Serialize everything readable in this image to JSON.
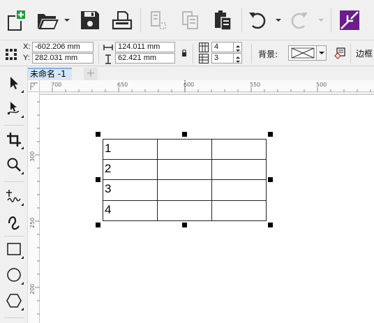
{
  "property_bar": {
    "x_label": "X:",
    "x_value": "-602.206 mm",
    "y_label": "Y:",
    "y_value": "282.031 mm",
    "width_value": "124.011 mm",
    "height_value": "62.421 mm",
    "columns_value": "4",
    "rows_value": "3",
    "background_label": "背景:",
    "border_label": "边框"
  },
  "tab": {
    "document_name": "未命名 -1",
    "new_tab_label": "+"
  },
  "rulers": {
    "top_numbers": [
      "700",
      "650",
      "600",
      "550",
      "500"
    ],
    "left_numbers": [
      "300",
      "250",
      "200"
    ]
  },
  "table": {
    "cells": [
      "1",
      "2",
      "3",
      "4"
    ]
  },
  "colors": {
    "accent": "#3f72c6",
    "tab_highlight": "#d5e6f7",
    "transform_icon": "#6a1e8c"
  }
}
